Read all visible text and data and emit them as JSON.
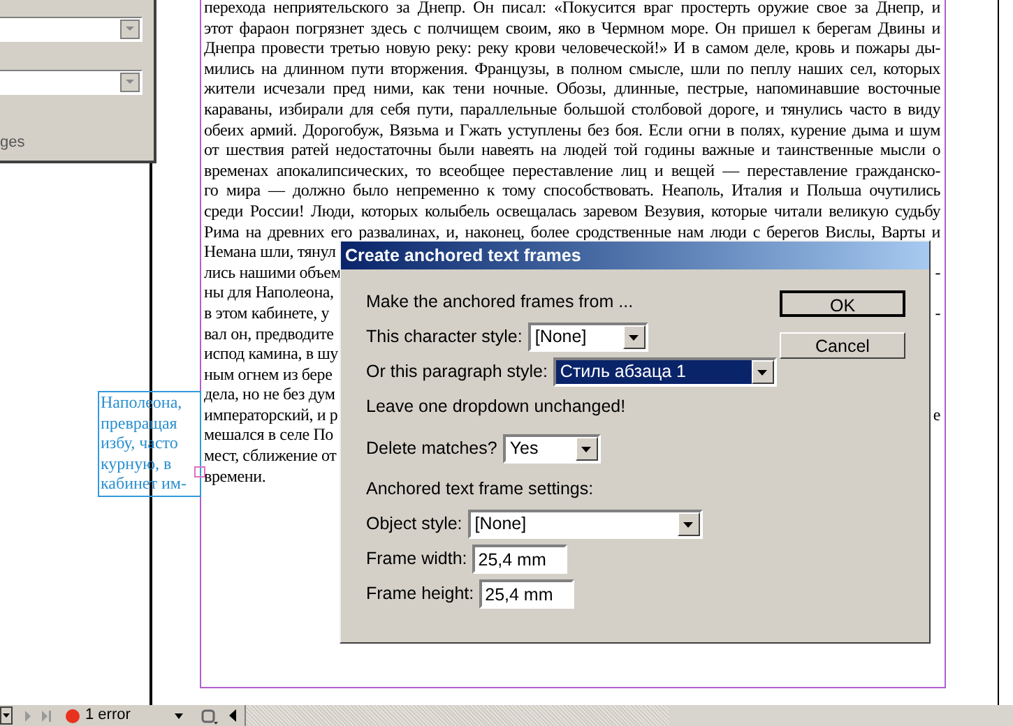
{
  "side_panel": {
    "caption": "ges"
  },
  "document": {
    "lines": [
      {
        "text": "перехода неприятельского за Днепр. Он писал: «Покусится враг простерть оружие свое за Днепр, и"
      },
      {
        "text": "этот фараон погрязнет здесь с полчищем своим, яко в Чермном море. Он пришел к берегам Двины и"
      },
      {
        "text": "Днепра провести третью новую реку: реку крови человеческой!» И в самом деле, кровь и пожары ды-"
      },
      {
        "text": "мились на длинном пути вторжения. Французы, в полном смысле, шли по пеплу наших сел, которых"
      },
      {
        "text": "жители исчезали пред ними, как тени ночные. Обозы, длинные, пестрые, напоминавшие восточные"
      },
      {
        "text": "караваны, избирали для себя пути, параллельные большой столбовой дороге, и тянулись часто в виду"
      },
      {
        "text": "обеих армий. Дорогобуж, Вязьма и Гжать уступлены без боя. Если огни в полях, курение дыма и шум"
      },
      {
        "text": "от шествия ратей недостаточны были навеять на людей той годины важные и таинственные мысли о"
      },
      {
        "text": "временах апокалипсических, то всеобщее переставление лиц и вещей — переставление гражданско-"
      },
      {
        "text": "го мира — должно было непременно к тому способствовать. Неаполь, Италия и Польша очутились"
      },
      {
        "text": "среди России! Люди, которых колыбель освещалась заревом Везувия, которые читали великую судьбу"
      },
      {
        "text": "Рима на древних его развалинах, и, наконец, более сродственные нам люди с берегов Вислы, Варты и"
      },
      {
        "text": "Немана шли, тянул"
      },
      {
        "text": "лись нашими объем",
        "right": "-"
      },
      {
        "text": "ны для Наполеона,"
      },
      {
        "text": "в этом кабинете, у",
        "right": "-"
      },
      {
        "text": "вал он, предводите"
      },
      {
        "text": "испод камина, в шу"
      },
      {
        "text": "ным огнем из бере"
      },
      {
        "text": "дела, но не без дум"
      },
      {
        "text": "императорский, и р",
        "right": "е"
      },
      {
        "text": "мешался в селе По"
      },
      {
        "text": "мест, сближение от"
      },
      {
        "text": "времени."
      }
    ],
    "side_note": [
      "Наполеона,",
      "превращая",
      "избу, часто",
      "курную, в",
      "кабинет им-"
    ]
  },
  "dialog": {
    "title": "Create anchored text frames",
    "rows": [
      {
        "kind": "label",
        "label": "Make the anchored frames from ..."
      },
      {
        "kind": "dropdown",
        "label": "This character style:",
        "value": "[None]",
        "focused": false
      },
      {
        "kind": "dropdown",
        "label": "Or this paragraph style:",
        "value": "Стиль абзаца 1",
        "focused": true
      },
      {
        "kind": "label",
        "label": "Leave one dropdown unchanged!"
      },
      {
        "kind": "dropdown",
        "label": "Delete matches?",
        "value": "Yes",
        "focused": false
      },
      {
        "kind": "label",
        "label": "Anchored text frame settings:"
      },
      {
        "kind": "dropdown",
        "label": "Object style:",
        "value": "[None]",
        "focused": false
      },
      {
        "kind": "input",
        "label": "Frame width:",
        "value": "25,4 mm"
      },
      {
        "kind": "input",
        "label": "Frame height:",
        "value": "25,4 mm"
      }
    ],
    "buttons": [
      {
        "label": "OK",
        "default": true
      },
      {
        "label": "Cancel",
        "default": false
      }
    ]
  },
  "status_bar": {
    "errors": "1 error"
  }
}
